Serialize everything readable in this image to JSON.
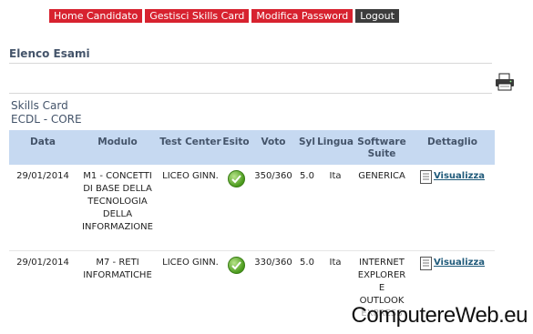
{
  "nav": {
    "home_label": "Home Candidato",
    "skills_label": "Gestisci Skills Card",
    "password_label": "Modifica Password",
    "logout_label": "Logout"
  },
  "section": {
    "title": "Elenco Esami"
  },
  "skills_card": {
    "line1": "Skills Card",
    "line2": "ECDL - CORE"
  },
  "icons": {
    "printer": "printer-icon",
    "passed": "check-circle-icon",
    "detail": "document-icon"
  },
  "table": {
    "headers": [
      "Data",
      "Modulo",
      "Test Center",
      "Esito",
      "Voto",
      "Syl",
      "Lingua",
      "Software Suite",
      "Dettaglio"
    ],
    "rows": [
      {
        "data": "29/01/2014",
        "modulo": "M1 - CONCETTI DI BASE DELLA TECNOLOGIA DELLA INFORMAZIONE",
        "test_center": "LICEO GINN.",
        "voto": "350/360",
        "syl": "5.0",
        "lingua": "Ita",
        "software": "GENERICA",
        "dettaglio": "Visualizza"
      },
      {
        "data": "29/01/2014",
        "modulo": "M7 - RETI INFORMATICHE",
        "test_center": "LICEO GINN.",
        "voto": "330/360",
        "syl": "5.0",
        "lingua": "Ita",
        "software": "INTERNET EXPLORER E OUTLOOK EXPRESS",
        "dettaglio": "Visualizza"
      }
    ]
  },
  "watermark": "ComputereWeb.eu",
  "colors": {
    "nav_red": "#d7222f",
    "nav_dark": "#3d3d3d",
    "header_bg": "#c6d9f1",
    "title": "#44546a",
    "link": "#1f5a7a"
  }
}
